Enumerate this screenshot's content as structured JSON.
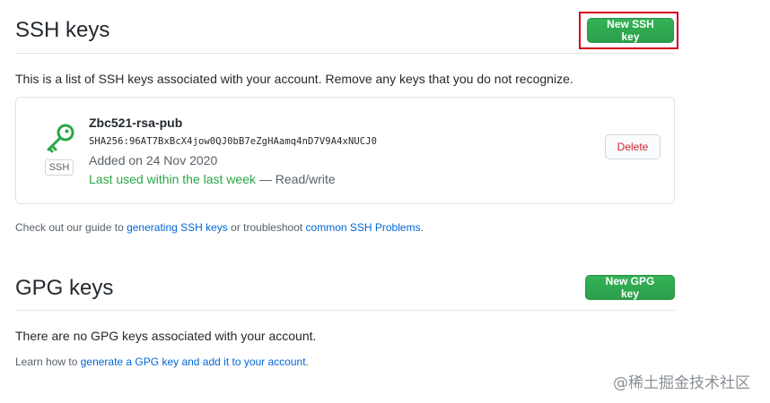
{
  "ssh": {
    "title": "SSH keys",
    "new_button": "New SSH key",
    "description": "This is a list of SSH keys associated with your account. Remove any keys that you do not recognize.",
    "key": {
      "type_badge": "SSH",
      "name": "Zbc521-rsa-pub",
      "fingerprint": "SHA256:96AT7BxBcX4jow0QJ0bB7eZgHAamq4nD7V9A4xNUCJ0",
      "added": "Added on 24 Nov 2020",
      "last_used": "Last used within the last week",
      "access": " — Read/write",
      "delete_button": "Delete"
    },
    "guide": {
      "prefix": "Check out our guide to ",
      "link1": "generating SSH keys",
      "middle": " or troubleshoot ",
      "link2": "common SSH Problems",
      "suffix": "."
    }
  },
  "gpg": {
    "title": "GPG keys",
    "new_button": "New GPG key",
    "empty_message": "There are no GPG keys associated with your account.",
    "learn": {
      "prefix": "Learn how to ",
      "link": "generate a GPG key and add it to your account",
      "suffix": "."
    }
  },
  "watermark": "@稀土掘金技术社区",
  "colors": {
    "primary_button": "#2ea44f",
    "highlight_border": "#d0021b",
    "link": "#0366d6",
    "danger": "#cb2431",
    "success_text": "#28a745"
  },
  "icons": {
    "key": "key-icon"
  }
}
